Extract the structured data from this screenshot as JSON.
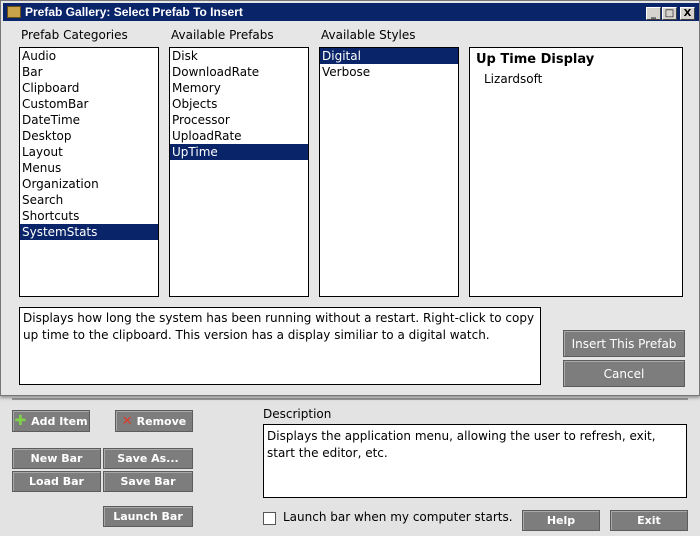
{
  "dialog": {
    "title": "Prefab Gallery: Select Prefab To Insert",
    "minimize": "_",
    "maximize": "□",
    "close": "X",
    "categories_label": "Prefab Categories",
    "prefabs_label": "Available Prefabs",
    "styles_label": "Available Styles",
    "categories": [
      "Audio",
      "Bar",
      "Clipboard",
      "CustomBar",
      "DateTime",
      "Desktop",
      "Layout",
      "Menus",
      "Organization",
      "Search",
      "Shortcuts",
      "SystemStats"
    ],
    "categories_selected": "SystemStats",
    "prefabs": [
      "Disk",
      "DownloadRate",
      "Memory",
      "Objects",
      "Processor",
      "UploadRate",
      "UpTime"
    ],
    "prefabs_selected": "UpTime",
    "styles": [
      "Digital",
      "Verbose"
    ],
    "styles_selected": "Digital",
    "info_title": "Up Time Display",
    "info_author": "Lizardsoft",
    "note": "Displays how long the system has been running without a restart. Right-click to copy up time to the clipboard. This version has a display similiar to a digital watch.",
    "insert_label": "Insert This Prefab",
    "cancel_label": "Cancel"
  },
  "background": {
    "add_item_label": "Add Item",
    "remove_label": "Remove",
    "new_bar_label": "New Bar",
    "save_as_label": "Save As...",
    "load_bar_label": "Load Bar",
    "save_bar_label": "Save Bar",
    "launch_bar_label": "Launch Bar",
    "description_label": "Description",
    "description_text": "Displays the application menu, allowing the user to refresh, exit, start the editor, etc.",
    "launch_checkbox_label": "Launch bar when my computer starts.",
    "launch_checked": false,
    "help_label": "Help",
    "exit_label": "Exit"
  },
  "colors": {
    "titlebar": "#0a246a",
    "selection": "#0a246a",
    "button": "#7d7d7d",
    "add_icon": "#7fd14a",
    "remove_icon": "#e03a2a"
  },
  "icons": {
    "add": "plus-icon",
    "remove": "x-icon"
  }
}
